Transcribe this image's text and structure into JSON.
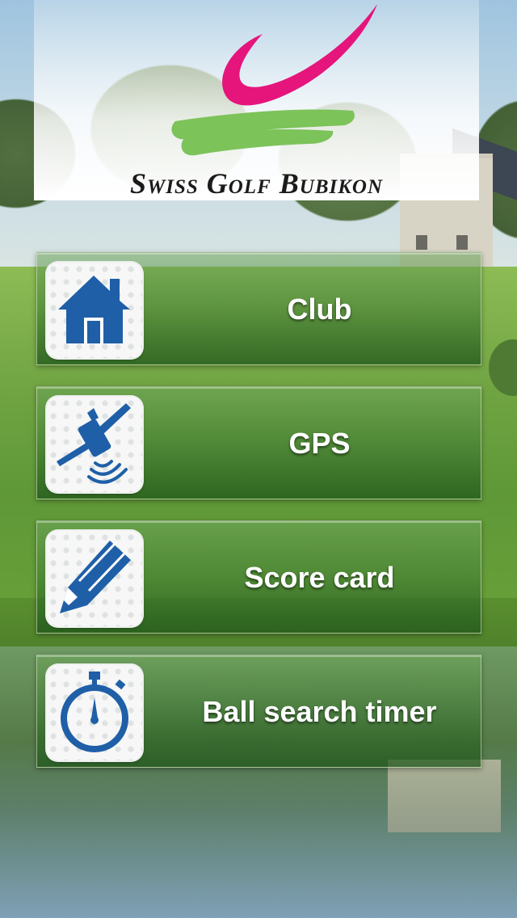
{
  "header": {
    "logo_text": "Swiss Golf Bubikon",
    "colors": {
      "swoosh": "#e5157c",
      "stroke": "#7cc35a"
    }
  },
  "menu": {
    "items": [
      {
        "label": "Club",
        "icon": "house-icon"
      },
      {
        "label": "GPS",
        "icon": "satellite-icon"
      },
      {
        "label": "Score card",
        "icon": "pencil-icon"
      },
      {
        "label": "Ball search timer",
        "icon": "stopwatch-icon"
      }
    ]
  },
  "colors": {
    "icon_blue": "#1f5fa8",
    "label": "#ffffff"
  }
}
